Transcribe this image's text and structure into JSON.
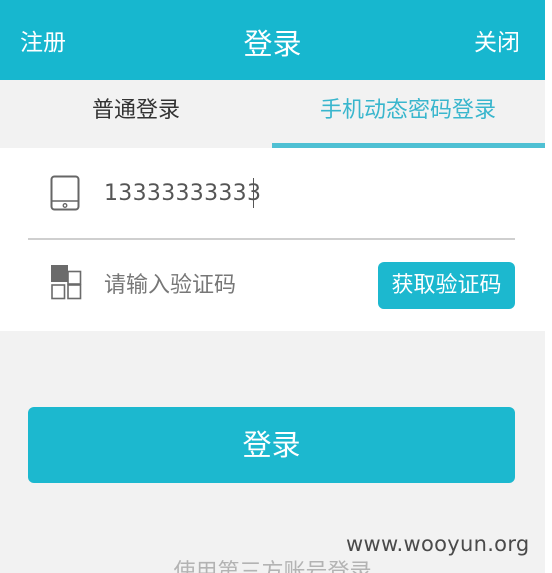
{
  "header": {
    "left_label": "注册",
    "title": "登录",
    "right_label": "关闭"
  },
  "tabs": [
    {
      "label": "普通登录",
      "active": false
    },
    {
      "label": "手机动态密码登录",
      "active": true
    }
  ],
  "form": {
    "phone": {
      "value": "13333333333",
      "icon": "mobile-phone-icon"
    },
    "code": {
      "placeholder": "请输入验证码",
      "icon": "verification-code-icon"
    },
    "get_code_label": "获取验证码"
  },
  "login_button": {
    "label": "登录"
  },
  "third_party_label": "使用第三方账号登录",
  "watermark": "www.wooyun.org",
  "colors": {
    "accent": "#17b7cf",
    "tab_active": "#39b6cd",
    "background": "#f2f2f2",
    "card": "#ffffff"
  }
}
